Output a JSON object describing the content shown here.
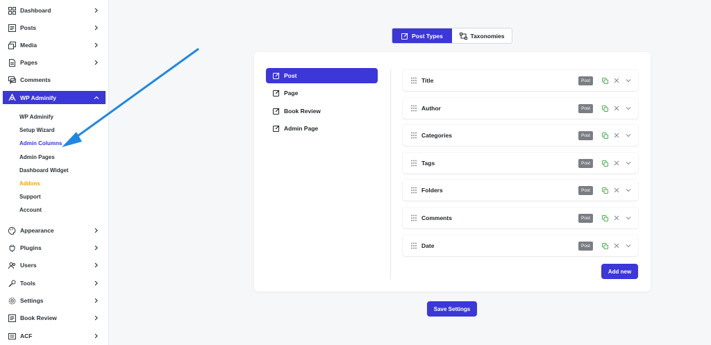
{
  "sidebar": {
    "items": [
      {
        "label": "Dashboard",
        "icon": "dashboard-icon"
      },
      {
        "label": "Posts",
        "icon": "posts-icon"
      },
      {
        "label": "Media",
        "icon": "media-icon"
      },
      {
        "label": "Pages",
        "icon": "pages-icon"
      },
      {
        "label": "Comments",
        "icon": "comments-icon"
      },
      {
        "label": "WP Adminify",
        "icon": "adminify-icon"
      },
      {
        "label": "Appearance",
        "icon": "appearance-icon"
      },
      {
        "label": "Plugins",
        "icon": "plugins-icon"
      },
      {
        "label": "Users",
        "icon": "users-icon"
      },
      {
        "label": "Tools",
        "icon": "tools-icon"
      },
      {
        "label": "Settings",
        "icon": "settings-icon"
      },
      {
        "label": "Book Review",
        "icon": "book-review-icon"
      },
      {
        "label": "ACF",
        "icon": "acf-icon"
      }
    ],
    "submenu": [
      {
        "label": "WP Adminify"
      },
      {
        "label": "Setup Wizard"
      },
      {
        "label": "Admin Columns"
      },
      {
        "label": "Admin Pages"
      },
      {
        "label": "Dashboard Widget"
      },
      {
        "label": "Addons"
      },
      {
        "label": "Support"
      },
      {
        "label": "Account"
      }
    ]
  },
  "tabs": {
    "post_types": "Post Types",
    "taxonomies": "Taxonomies"
  },
  "post_types": [
    {
      "label": "Post"
    },
    {
      "label": "Page"
    },
    {
      "label": "Book Review"
    },
    {
      "label": "Admin Page"
    }
  ],
  "columns": [
    {
      "label": "Title",
      "badge": "Post"
    },
    {
      "label": "Author",
      "badge": "Post"
    },
    {
      "label": "Categories",
      "badge": "Post"
    },
    {
      "label": "Tags",
      "badge": "Post"
    },
    {
      "label": "Folders",
      "badge": "Post"
    },
    {
      "label": "Comments",
      "badge": "Post"
    },
    {
      "label": "Date",
      "badge": "Post"
    }
  ],
  "buttons": {
    "add_new": "Add new",
    "save_settings": "Save Settings"
  },
  "colors": {
    "accent": "#3b37d8",
    "addons": "#f0a500",
    "arrow": "#1e88e5",
    "copy_icon": "#4caf50",
    "badge": "#7a7d83"
  }
}
